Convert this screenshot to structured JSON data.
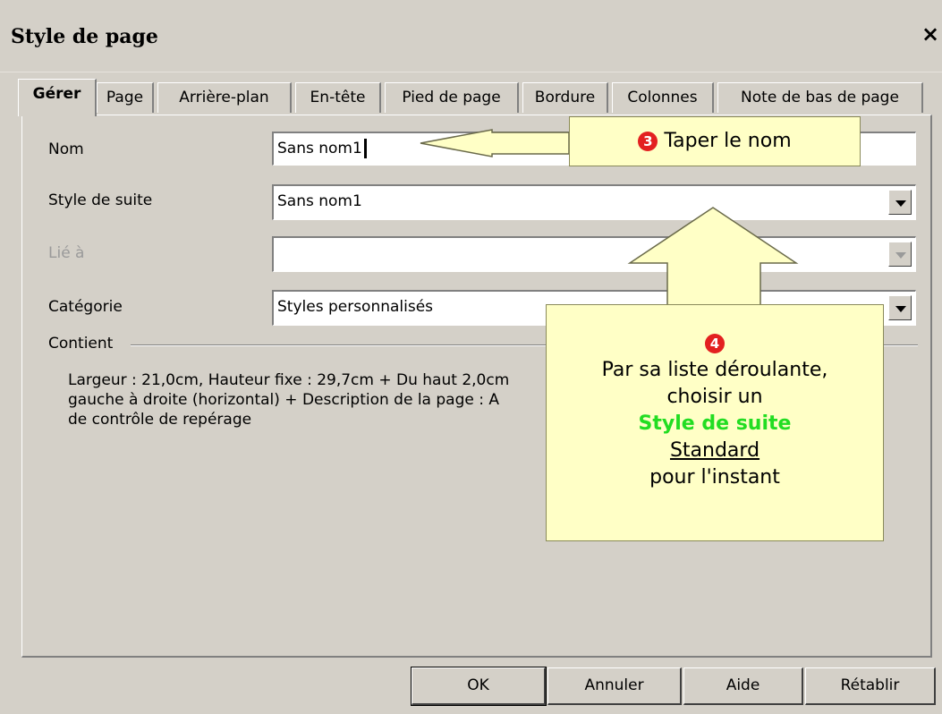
{
  "dialog": {
    "title": "Style de page",
    "close_label": "×"
  },
  "tabs": [
    {
      "label": "Gérer",
      "active": true
    },
    {
      "label": "Page"
    },
    {
      "label": "Arrière-plan"
    },
    {
      "label": "En-tête"
    },
    {
      "label": "Pied de page"
    },
    {
      "label": "Bordure"
    },
    {
      "label": "Colonnes"
    },
    {
      "label": "Note de bas de page"
    }
  ],
  "form": {
    "nom_label": "Nom",
    "nom_value": "Sans nom1",
    "suite_label": "Style de suite",
    "suite_value": "Sans nom1",
    "lie_label": "Lié à",
    "lie_value": "",
    "categorie_label": "Catégorie",
    "categorie_value": "Styles personnalisés"
  },
  "contient": {
    "label": "Contient",
    "line1": "Largeur : 21,0cm, Hauteur fixe : 29,7cm + Du haut 2,0cm",
    "line2": "gauche à droite (horizontal) + Description de la page : A",
    "line3": "de contrôle de repérage"
  },
  "buttons": {
    "ok": "OK",
    "annuler": "Annuler",
    "aide": "Aide",
    "retablir": "Rétablir"
  },
  "callouts": {
    "c3_num": "3",
    "c3_text": "Taper le nom",
    "c4_num": "4",
    "c4_line1": "Par sa liste déroulante,",
    "c4_line2": "choisir un",
    "c4_line3": "Style de suite",
    "c4_line4": "Standard",
    "c4_line5": "pour l'instant"
  },
  "colors": {
    "callout_bg": "#ffffc6",
    "number_bg": "#e32020",
    "highlight": "#22dd22",
    "dialog_bg": "#d4d0c8"
  }
}
